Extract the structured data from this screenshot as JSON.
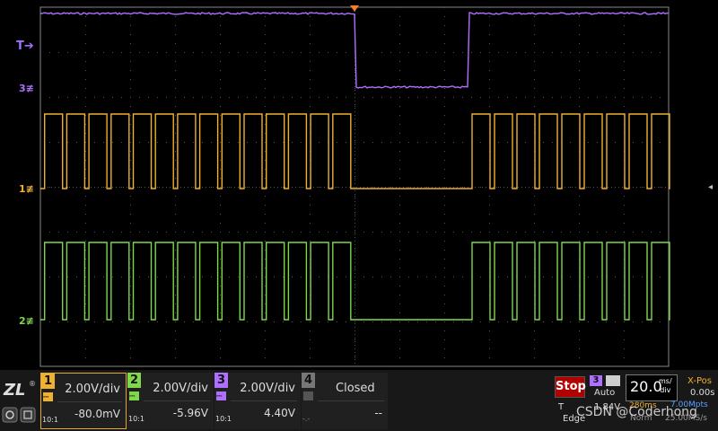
{
  "markers": {
    "trigger_level": "T",
    "ch3": "3",
    "ch1": "1",
    "ch2": "2"
  },
  "channels": [
    {
      "number": "1",
      "volts_per_div": "2.00V/div",
      "offset": "-80.0mV",
      "probe_ratio": "10:1",
      "color": "#f0b030"
    },
    {
      "number": "2",
      "volts_per_div": "2.00V/div",
      "offset": "-5.96V",
      "probe_ratio": "10:1",
      "color": "#7ed84a"
    },
    {
      "number": "3",
      "volts_per_div": "2.00V/div",
      "offset": "4.40V",
      "probe_ratio": "10:1",
      "color": "#b070ff"
    },
    {
      "number": "4",
      "status": "Closed",
      "offset": "--",
      "probe_ratio": "-.-"
    }
  ],
  "run_state": "Stop",
  "trigger": {
    "source": "3",
    "mode": "Auto",
    "t_label": "T",
    "level": "1.84V",
    "type": "Edge"
  },
  "timebase": {
    "value": "20.0",
    "unit_top": "ms/",
    "unit_bottom": "div",
    "record_time": "280ms",
    "sample_rate": "7.00Mpts",
    "acq_mode": "Norm",
    "sample_points": "25.00MS/s"
  },
  "x_position": {
    "label": "X-Pos",
    "value": "0.00s"
  },
  "watermark": "CSDN @Coderhong",
  "colors": {
    "ch1": "#f0b030",
    "ch2": "#7ed84a",
    "ch3": "#b070ff",
    "stop": "#b00000",
    "sample_rate": "#5aa0ff"
  },
  "icons": [
    "zlg-logo",
    "trigger-position-marker",
    "screenshot-icon",
    "save-icon",
    "right-collapse-handle"
  ]
}
